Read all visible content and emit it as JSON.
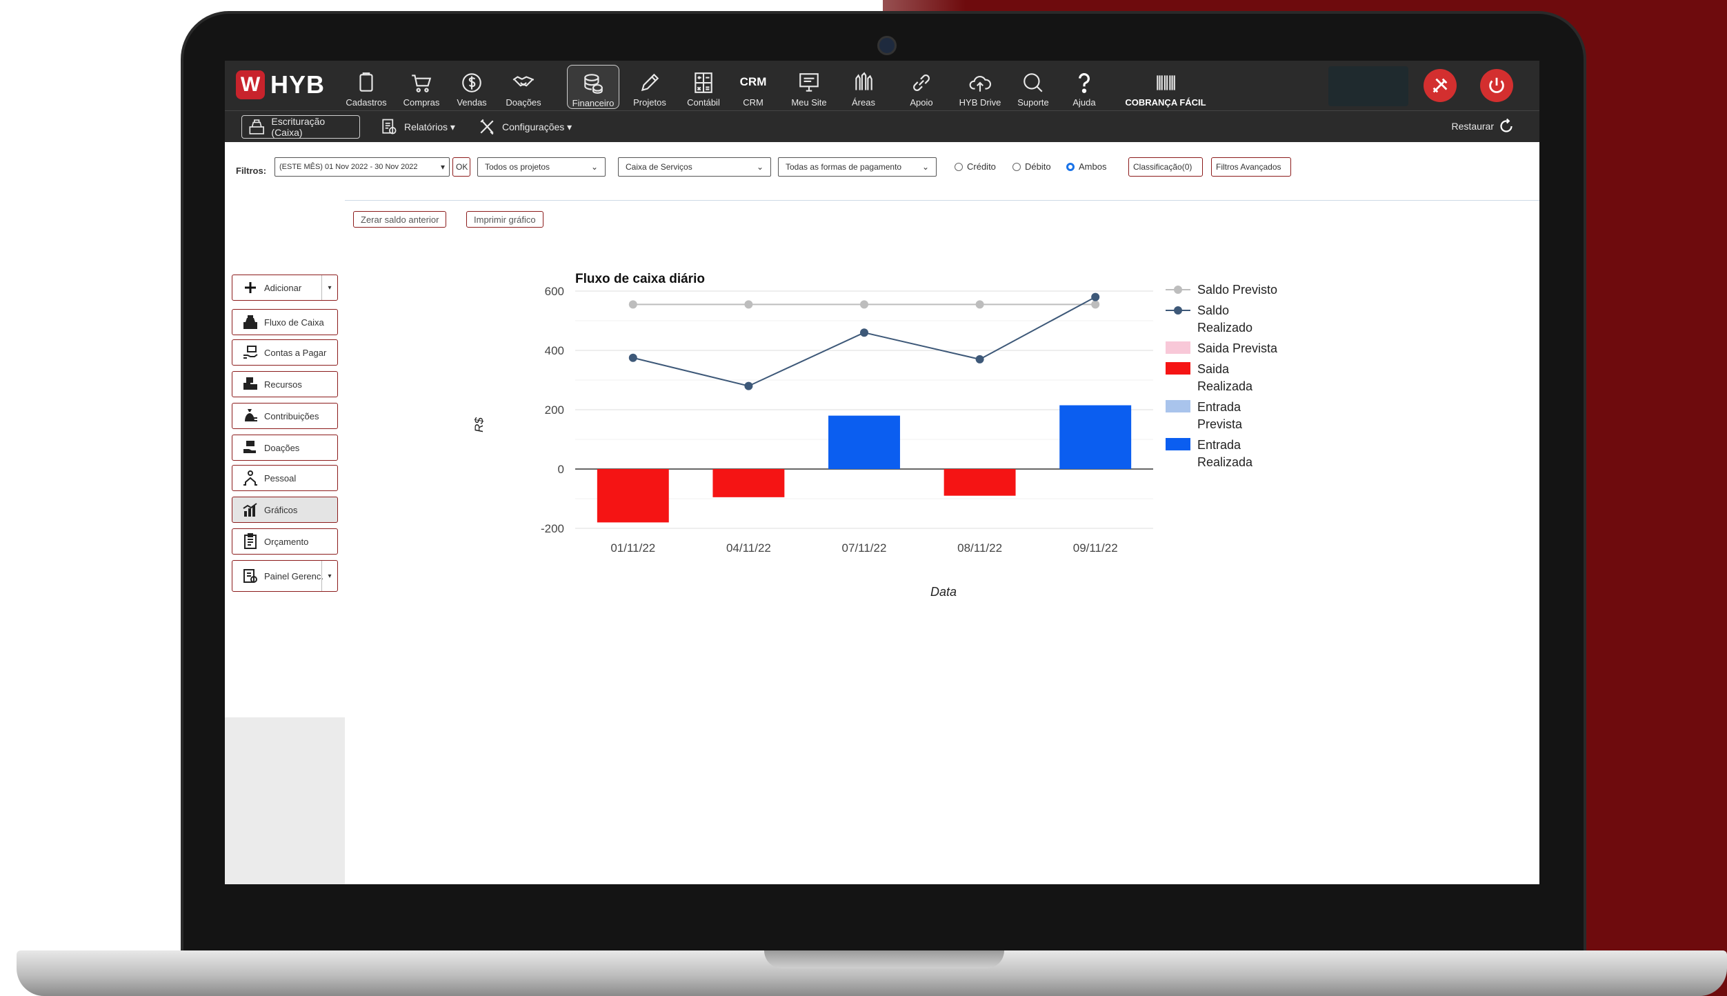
{
  "app": {
    "logo_text": "HYB",
    "brand_color": "#c8232c"
  },
  "nav": [
    {
      "label": "Cadastros",
      "icon": "clipboard-icon"
    },
    {
      "label": "Compras",
      "icon": "cart-icon"
    },
    {
      "label": "Vendas",
      "icon": "dollar-icon"
    },
    {
      "label": "Doações",
      "icon": "handshake-icon"
    },
    {
      "label": "Financeiro",
      "icon": "coins-icon",
      "active": true
    },
    {
      "label": "Projetos",
      "icon": "pencil-icon"
    },
    {
      "label": "Contábil",
      "icon": "calculator-icon"
    },
    {
      "label": "CRM",
      "icon": "crm-text"
    },
    {
      "label": "Meu Site",
      "icon": "monitor-icon"
    },
    {
      "label": "Áreas",
      "icon": "hands-icon"
    },
    {
      "label": "Apoio",
      "icon": "link-icon"
    },
    {
      "label": "HYB Drive",
      "icon": "cloud-upload-icon"
    },
    {
      "label": "Suporte",
      "icon": "chat-icon"
    },
    {
      "label": "Ajuda",
      "icon": "question-icon"
    },
    {
      "label": "COBRANÇA FÁCIL",
      "icon": "barcode-icon"
    }
  ],
  "subnav": {
    "escrituracao": "Escrituração (Caixa)",
    "relatorios": "Relatórios",
    "configuracoes": "Configurações",
    "restaurar": "Restaurar"
  },
  "filters": {
    "label": "Filtros:",
    "period": "(ESTE MÊS) 01 Nov 2022 - 30 Nov 2022",
    "ok": "OK",
    "project": "Todos os projetos",
    "account": "Caixa de Serviços",
    "payment": "Todas as formas de pagamento",
    "radio_credito": "Crédito",
    "radio_debito": "Débito",
    "radio_ambos": "Ambos",
    "selected": "Ambos",
    "classificacao": "Classificação(0)",
    "avancados": "Filtros Avançados"
  },
  "sidebar": {
    "items": [
      {
        "label": "Adicionar",
        "icon": "plus-icon"
      },
      {
        "label": "Fluxo de Caixa",
        "icon": "register-icon"
      },
      {
        "label": "Contas a Pagar",
        "icon": "money-hand-icon"
      },
      {
        "label": "Recursos",
        "icon": "boxes-icon"
      },
      {
        "label": "Contribuições",
        "icon": "money-bag-icon"
      },
      {
        "label": "Doações",
        "icon": "donate-icon"
      },
      {
        "label": "Pessoal",
        "icon": "people-icon"
      },
      {
        "label": "Gráficos",
        "icon": "bar-chart-icon",
        "active": true
      },
      {
        "label": "Orçamento",
        "icon": "checklist-icon"
      },
      {
        "label": "Painel Gerenc.",
        "icon": "dashboard-icon"
      }
    ]
  },
  "actions": {
    "zerar": "Zerar saldo anterior",
    "imprimir": "Imprimir gráfico"
  },
  "chart_data": {
    "type": "bar",
    "title": "Fluxo de caixa diário",
    "xlabel": "Data",
    "ylabel": "R$",
    "ylim": [
      -200,
      600
    ],
    "yticks": [
      -200,
      0,
      200,
      400,
      600
    ],
    "categories": [
      "01/11/22",
      "04/11/22",
      "07/11/22",
      "08/11/22",
      "09/11/22"
    ],
    "legend_position": "right",
    "series": [
      {
        "name": "Saldo Previsto",
        "kind": "line",
        "color": "#bdbdbd",
        "values": [
          555,
          555,
          555,
          555,
          555
        ]
      },
      {
        "name": "Saldo Realizado",
        "kind": "line",
        "color": "#3d5878",
        "values": [
          375,
          280,
          460,
          370,
          580
        ]
      },
      {
        "name": "Saida Prevista",
        "kind": "bar",
        "color": "#f8c8d8",
        "values": [
          0,
          0,
          0,
          0,
          0
        ]
      },
      {
        "name": "Saida Realizada",
        "kind": "bar",
        "color": "#f51414",
        "values": [
          -180,
          -95,
          0,
          -90,
          0
        ]
      },
      {
        "name": "Entrada Prevista",
        "kind": "bar",
        "color": "#a9c4ec",
        "values": [
          0,
          0,
          0,
          0,
          0
        ]
      },
      {
        "name": "Entrada Realizada",
        "kind": "bar",
        "color": "#0b5ef0",
        "values": [
          0,
          0,
          180,
          0,
          215
        ]
      }
    ]
  }
}
